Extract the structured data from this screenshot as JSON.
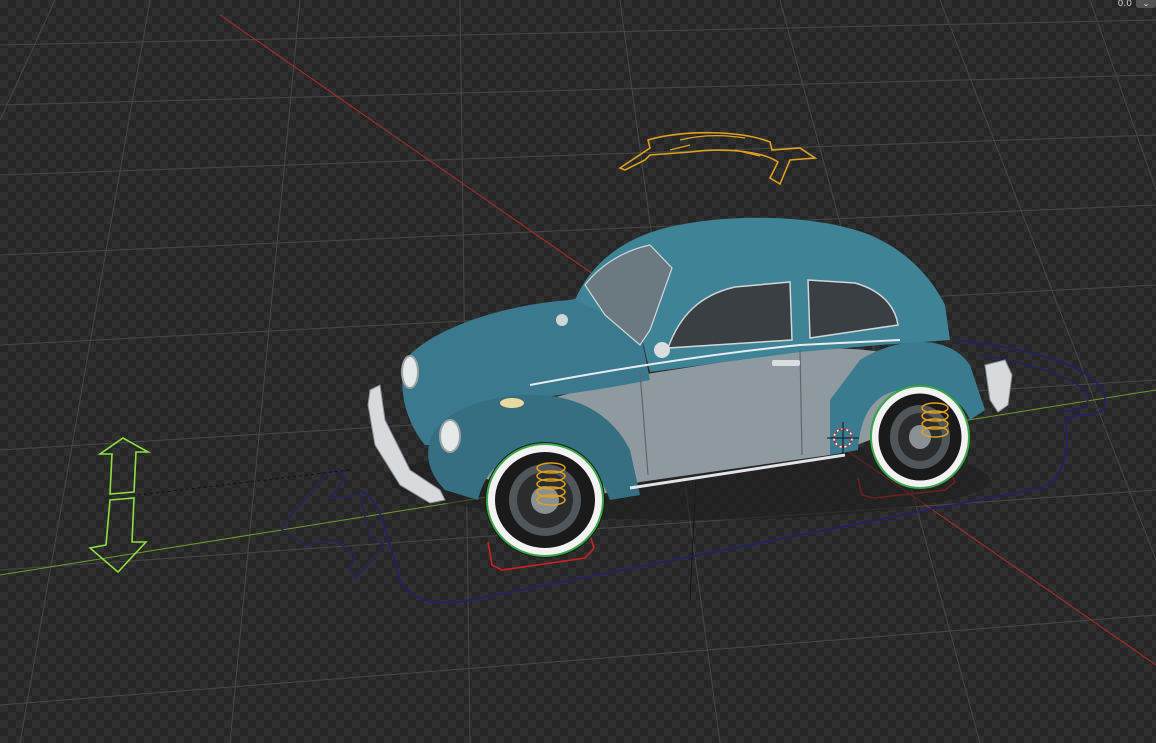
{
  "app": {
    "view": "3D Viewport"
  },
  "overlay": {
    "corner_text": "0.0",
    "button_icon": "chevron-down-icon"
  },
  "colors": {
    "x_axis": "#b02a2a",
    "y_axis": "#6f9a2a",
    "z_axis": "#1a1a1a",
    "rig_outline": "#202070",
    "rotate_gizmo": "#e0a020",
    "height_gizmo": "#8ee040",
    "forward_gizmo": "#24245e",
    "wheel_ring": "#3aa84a",
    "wheel_lock": "#cc2222",
    "suspension_spring": "#e0a020",
    "car_paint": "#3b7a8e",
    "car_lower_body": "#8f9aa0"
  }
}
